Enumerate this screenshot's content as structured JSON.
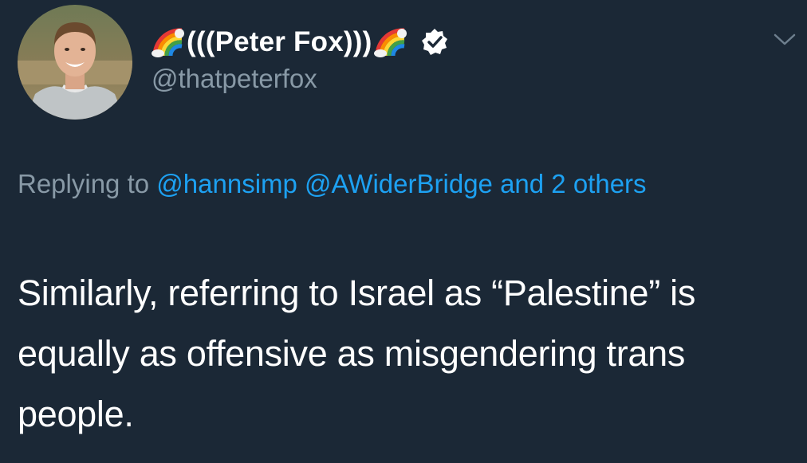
{
  "tweet": {
    "display_name": "(((Peter Fox)))",
    "handle": "@thatpeterfox",
    "replying_prefix": "Replying to",
    "replying_mentions": [
      "@hannsimp",
      "@AWiderBridge"
    ],
    "replying_suffix": "and 2 others",
    "text": "Similarly, referring to Israel as “Palestine” is equally as offensive as misgendering trans people."
  },
  "icons": {
    "avatar": "profile-photo",
    "rainbow": "rainbow-emoji",
    "verified": "verified-badge-icon",
    "menu": "chevron-down-icon"
  },
  "colors": {
    "background": "#1b2836",
    "text": "#ffffff",
    "muted": "#8899a6",
    "link": "#1da1f2"
  }
}
